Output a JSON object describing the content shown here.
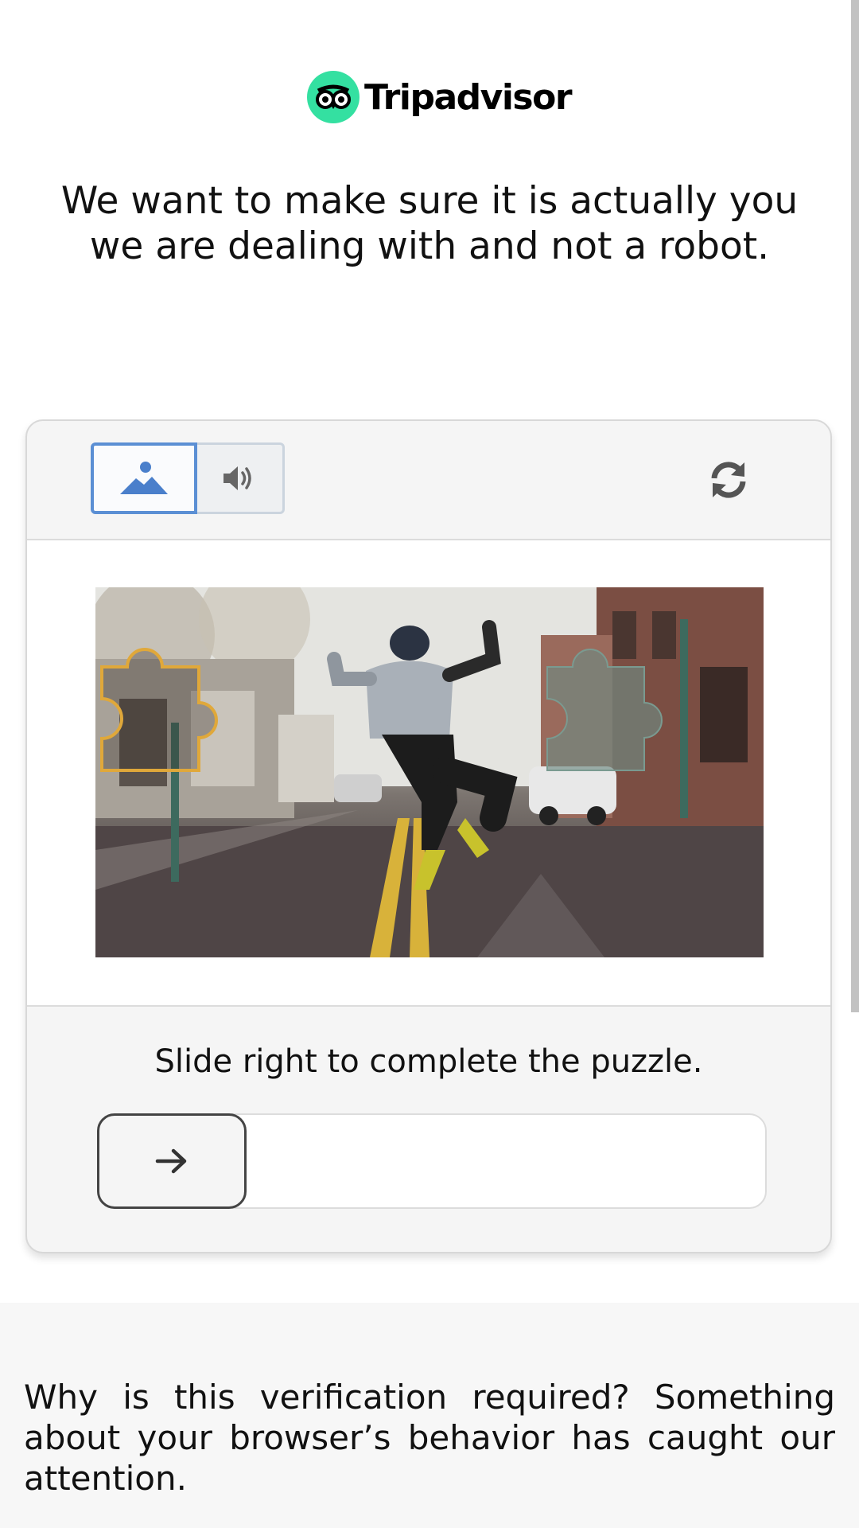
{
  "brand": {
    "name": "Tripadvisor",
    "accent": "#34e0a1"
  },
  "headline": "We want to make sure it is actually you we are dealing with and not a robot.",
  "captcha": {
    "mode_image_icon": "image-icon",
    "mode_audio_icon": "speaker-icon",
    "refresh_icon": "refresh-icon",
    "active_mode": "image",
    "instruction": "Slide right to complete the puzzle.",
    "slider_icon": "arrow-right-icon",
    "slider_progress": 0,
    "colors": {
      "active_border": "#5b8fd4",
      "piece_outline": "#e0a83a"
    }
  },
  "footer": {
    "text": "Why is this verification required? Something about your browser’s behavior has caught our attention."
  }
}
